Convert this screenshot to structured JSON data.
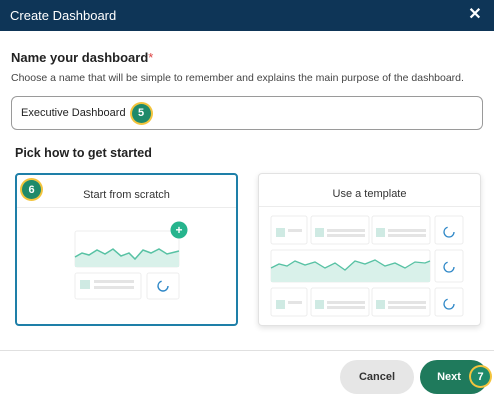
{
  "dialog": {
    "title": "Create Dashboard",
    "close_glyph": "✕"
  },
  "name_section": {
    "label": "Name your dashboard",
    "required_mark": "*",
    "help_text": "Choose a name that will be simple to remember and explains the main purpose of the dashboard.",
    "input_value": "Executive Dashboard",
    "step_badge": "5"
  },
  "pick_section": {
    "label": "Pick how to get started",
    "options": [
      {
        "title": "Start from scratch",
        "step_badge": "6",
        "selected": true
      },
      {
        "title": "Use a template",
        "selected": false
      }
    ]
  },
  "footer": {
    "cancel_label": "Cancel",
    "next_label": "Next",
    "next_step_badge": "7"
  },
  "colors": {
    "header": "#0e3557",
    "accent": "#1f8a6a",
    "selected_border": "#1e7fa8",
    "badge_ring": "#f3c43d"
  }
}
